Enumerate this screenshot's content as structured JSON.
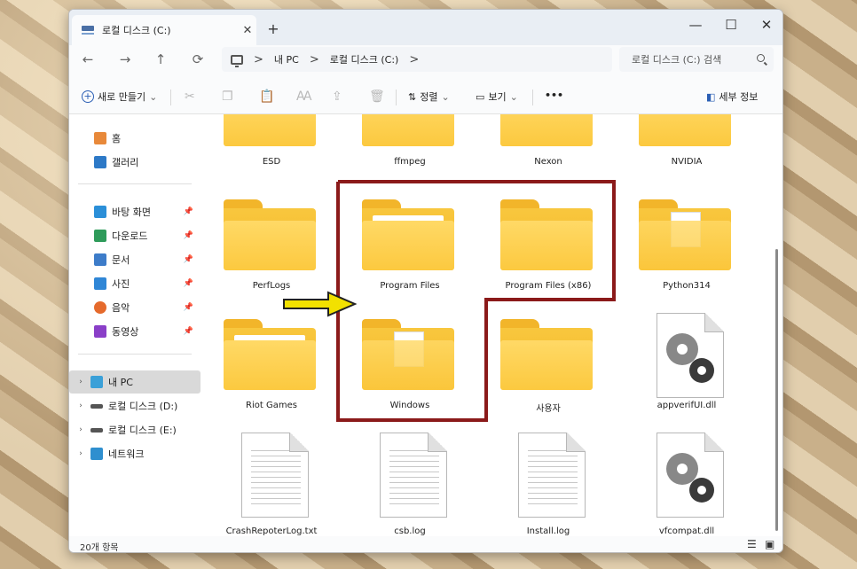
{
  "window": {
    "tab_title": "로컬 디스크 (C:)",
    "tab_close": "✕",
    "new_tab": "+",
    "minimize": "—",
    "maximize": "☐",
    "close": "✕"
  },
  "nav": {
    "back": "←",
    "forward": "→",
    "up": "↑",
    "refresh": "⟳",
    "breadcrumb": [
      "내 PC",
      "로컬 디스크 (C:)"
    ],
    "crumb_separator": ">",
    "search_placeholder": "로컬 디스크 (C:) 검색"
  },
  "toolbar": {
    "new_label": "새로 만들기",
    "new_chevron": "⌄",
    "sort_label": "정렬",
    "view_label": "보기",
    "more_label": "•••",
    "details_label": "세부 정보"
  },
  "sidebar": {
    "quick": [
      {
        "label": "홈",
        "icon": "home-icon"
      },
      {
        "label": "갤러리",
        "icon": "gallery-icon"
      }
    ],
    "pinned": [
      {
        "label": "바탕 화면",
        "icon": "desktop-icon"
      },
      {
        "label": "다운로드",
        "icon": "download-icon"
      },
      {
        "label": "문서",
        "icon": "documents-icon"
      },
      {
        "label": "사진",
        "icon": "pictures-icon"
      },
      {
        "label": "음악",
        "icon": "music-icon"
      },
      {
        "label": "동영상",
        "icon": "videos-icon"
      }
    ],
    "devices": [
      {
        "label": "내 PC",
        "icon": "pc-icon",
        "selected": true
      },
      {
        "label": "로컬 디스크 (D:)",
        "icon": "drive-icon",
        "selected": false
      },
      {
        "label": "로컬 디스크 (E:)",
        "icon": "drive-icon",
        "selected": false
      },
      {
        "label": "네트워크",
        "icon": "network-icon",
        "selected": false
      }
    ]
  },
  "files": [
    {
      "name": "ESD",
      "kind": "folder"
    },
    {
      "name": "ffmpeg",
      "kind": "folder"
    },
    {
      "name": "Nexon",
      "kind": "folder"
    },
    {
      "name": "NVIDIA",
      "kind": "folder"
    },
    {
      "name": "PerfLogs",
      "kind": "folder"
    },
    {
      "name": "Program Files",
      "kind": "folder-content"
    },
    {
      "name": "Program Files (x86)",
      "kind": "folder"
    },
    {
      "name": "Python314",
      "kind": "folder-doc"
    },
    {
      "name": "Riot Games",
      "kind": "folder"
    },
    {
      "name": "Windows",
      "kind": "folder-doc"
    },
    {
      "name": "사용자",
      "kind": "folder"
    },
    {
      "name": "appverifUI.dll",
      "kind": "dll"
    },
    {
      "name": "CrashRepoterLog.txt",
      "kind": "text"
    },
    {
      "name": "csb.log",
      "kind": "text"
    },
    {
      "name": "Install.log",
      "kind": "text"
    },
    {
      "name": "vfcompat.dll",
      "kind": "dll"
    }
  ],
  "status": {
    "count": "20개 항목"
  },
  "colors": {
    "folder": "#f8c73e",
    "highlight_border": "#8b1a1a",
    "arrow": "#f2e100",
    "accent": "#2b5fb4"
  }
}
